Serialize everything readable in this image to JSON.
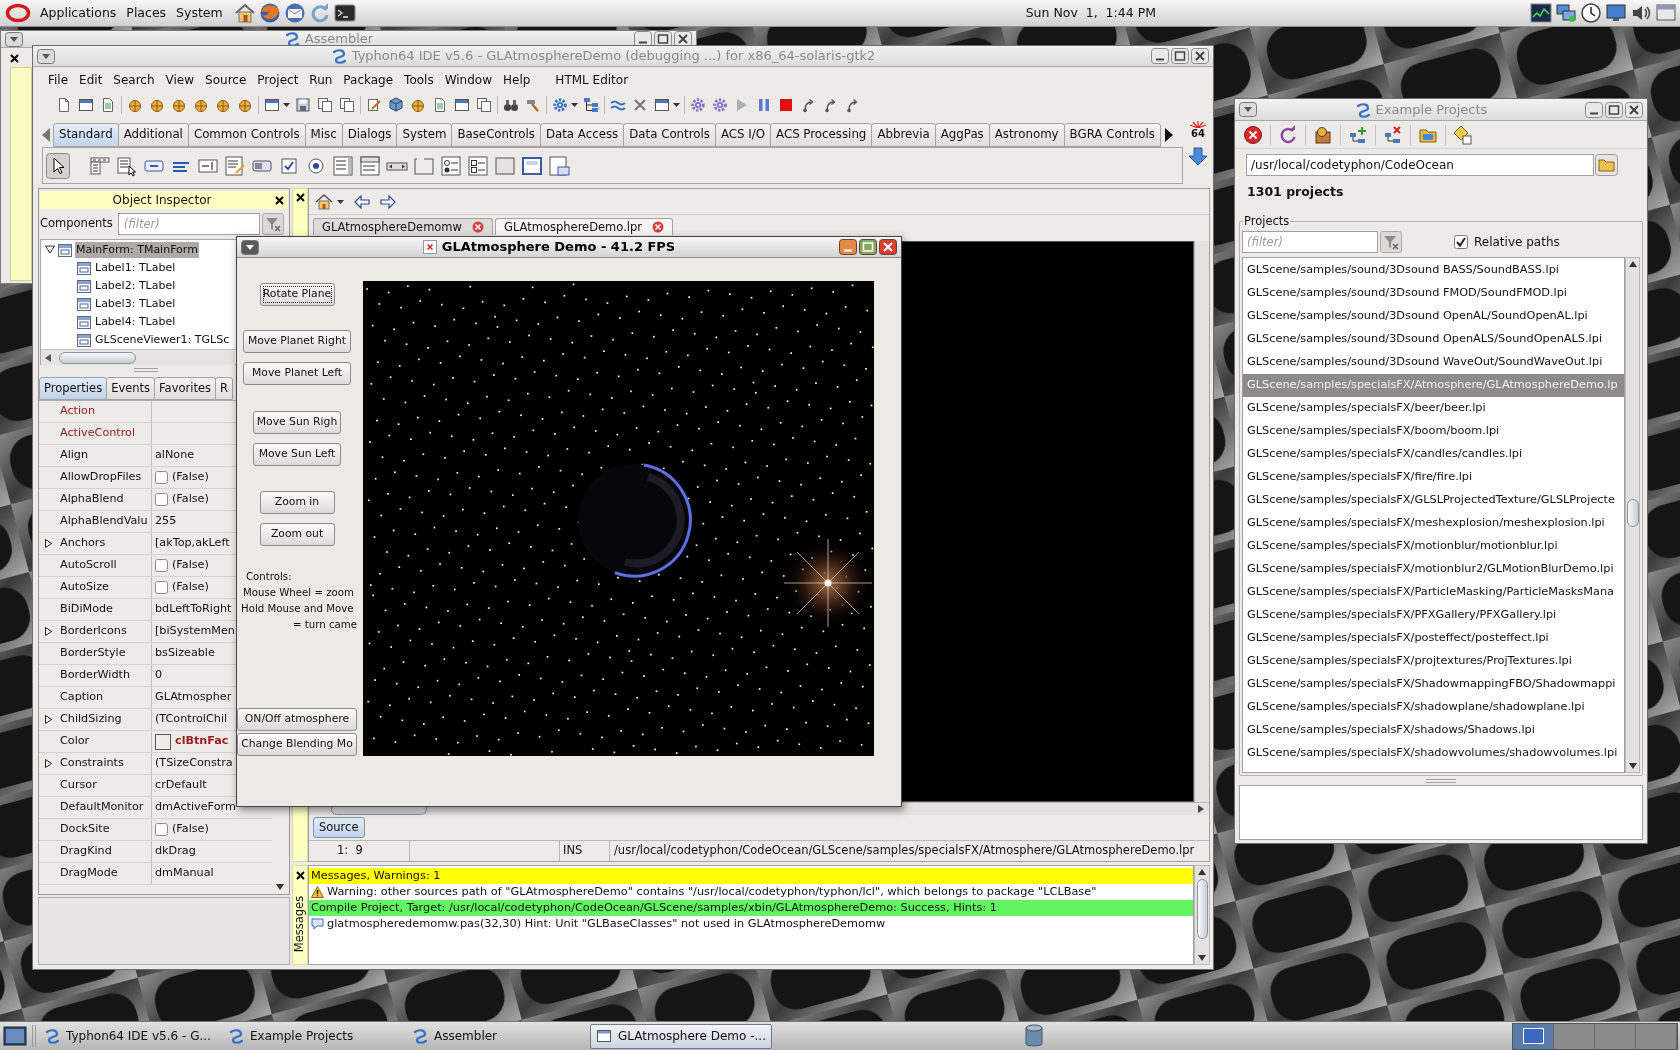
{
  "top_panel": {
    "menus": [
      "Applications",
      "Places",
      "System"
    ],
    "clock": "Sun Nov  1,  1:44 PM"
  },
  "assembler_window": {
    "title": "Assembler",
    "active": false
  },
  "ide_window": {
    "title": "Typhon64 IDE v5.6 - GLAtmosphereDemo (debugging ...) for x86_64-solaris-gtk2",
    "active": false,
    "menu": [
      "File",
      "Edit",
      "Search",
      "View",
      "Source",
      "Project",
      "Run",
      "Package",
      "Tools",
      "Window",
      "Help",
      "HTML Editor"
    ],
    "palette_tabs": [
      {
        "label": "Standard",
        "selected": true
      },
      {
        "label": "Additional",
        "selected": false
      },
      {
        "label": "Common Controls",
        "selected": false
      },
      {
        "label": "Misc",
        "selected": false
      },
      {
        "label": "Dialogs",
        "selected": false
      },
      {
        "label": "System",
        "selected": false
      },
      {
        "label": "BaseControls",
        "selected": false
      },
      {
        "label": "Data Access",
        "selected": false
      },
      {
        "label": "Data Controls",
        "selected": false
      },
      {
        "label": "ACS I/O",
        "selected": false
      },
      {
        "label": "ACS Processing",
        "selected": false
      },
      {
        "label": "Abbrevia",
        "selected": false
      },
      {
        "label": "AggPas",
        "selected": false
      },
      {
        "label": "Astronomy",
        "selected": false
      },
      {
        "label": "BGRA Controls",
        "selected": false
      }
    ],
    "palette_badge": "64",
    "object_inspector": {
      "title": "Object Inspector",
      "filter_label": "Components",
      "filter_placeholder": "(filter)",
      "tree": [
        {
          "label": "MainForm: TMainForm",
          "selected": true,
          "expanded": true,
          "children": [
            {
              "label": "Label1: TLabel",
              "selected": false
            },
            {
              "label": "Label2: TLabel",
              "selected": false
            },
            {
              "label": "Label3: TLabel",
              "selected": false
            },
            {
              "label": "Label4: TLabel",
              "selected": false
            },
            {
              "label": "GLSceneViewer1: TGLSc",
              "selected": false
            }
          ]
        }
      ],
      "tabs": [
        {
          "label": "Properties",
          "selected": true
        },
        {
          "label": "Events",
          "selected": false
        },
        {
          "label": "Favorites",
          "selected": false
        },
        {
          "label": "R",
          "selected": false
        }
      ],
      "properties": [
        {
          "name": "Action",
          "kind": "reference"
        },
        {
          "name": "ActiveControl",
          "kind": "reference"
        },
        {
          "name": "Align",
          "kind": "text",
          "value": "alNone"
        },
        {
          "name": "AllowDropFiles",
          "kind": "bool",
          "checked": false,
          "value": "(False)"
        },
        {
          "name": "AlphaBlend",
          "kind": "bool",
          "checked": false,
          "value": "(False)"
        },
        {
          "name": "AlphaBlendValu",
          "kind": "text",
          "value": "255"
        },
        {
          "name": "Anchors",
          "kind": "text",
          "expanded": false,
          "value": "[akTop,akLeft"
        },
        {
          "name": "AutoScroll",
          "kind": "bool",
          "checked": false,
          "value": "(False)"
        },
        {
          "name": "AutoSize",
          "kind": "bool",
          "checked": false,
          "value": "(False)"
        },
        {
          "name": "BiDiMode",
          "kind": "text",
          "value": "bdLeftToRight"
        },
        {
          "name": "BorderIcons",
          "kind": "text",
          "expanded": false,
          "value": "[biSystemMen"
        },
        {
          "name": "BorderStyle",
          "kind": "text",
          "value": "bsSizeable"
        },
        {
          "name": "BorderWidth",
          "kind": "text",
          "value": "0"
        },
        {
          "name": "Caption",
          "kind": "text",
          "value": "GLAtmospher"
        },
        {
          "name": "ChildSizing",
          "kind": "text",
          "expanded": false,
          "value": "(TControlChil"
        },
        {
          "name": "Color",
          "kind": "color",
          "value": "clBtnFac"
        },
        {
          "name": "Constraints",
          "kind": "text",
          "expanded": false,
          "value": "(TSizeConstra"
        },
        {
          "name": "Cursor",
          "kind": "text",
          "value": "crDefault"
        },
        {
          "name": "DefaultMonitor",
          "kind": "text",
          "value": "dmActiveForm"
        },
        {
          "name": "DockSite",
          "kind": "bool",
          "checked": false,
          "value": "(False)"
        },
        {
          "name": "DragKind",
          "kind": "text",
          "value": "dkDrag"
        },
        {
          "name": "DragMode",
          "kind": "text",
          "value": "dmManual"
        }
      ]
    },
    "editor": {
      "tabs": [
        {
          "label": "GLAtmosphereDemomw",
          "selected": false
        },
        {
          "label": "GLAtmosphereDemo.lpr",
          "selected": true
        }
      ],
      "page_tabs": [
        {
          "label": "Source",
          "selected": true
        }
      ],
      "status": {
        "position": "1:  9",
        "mode": "INS",
        "file": "/usr/local/codetyphon/CodeOcean/GLScene/samples/specialsFX/Atmosphere/GLAtmosphereDemo.lpr"
      }
    },
    "messages": {
      "title": "Messages",
      "rows": [
        {
          "kind": "header",
          "text": "Messages, Warnings: 1"
        },
        {
          "kind": "warning",
          "text": "Warning: other sources path of \"GLAtmosphereDemo\" contains \"/usr/local/codetyphon/typhon/lcl\", which belongs to package \"LCLBase\""
        },
        {
          "kind": "success",
          "text": "Compile Project, Target: /usr/local/codetyphon/CodeOcean/GLScene/samples/xbin/GLAtmosphereDemo: Success, Hints: 1"
        },
        {
          "kind": "hint",
          "text": "glatmospheredemomw.pas(32,30) Hint: Unit \"GLBaseClasses\" not used in GLAtmosphereDemomw"
        }
      ]
    }
  },
  "demo_window": {
    "title": "GLAtmosphere Demo - 41.2 FPS",
    "active": true,
    "button_groups": [
      [
        {
          "label": "Rotate Plane",
          "focused": true
        }
      ],
      [
        {
          "label": "Move Planet Right",
          "focused": false
        },
        {
          "label": "Move Planet Left",
          "focused": false
        }
      ],
      [
        {
          "label": "Move Sun Righ",
          "focused": false
        },
        {
          "label": "Move Sun Left",
          "focused": false
        }
      ],
      [
        {
          "label": "Zoom in",
          "focused": false
        },
        {
          "label": "Zoom out",
          "focused": false
        }
      ]
    ],
    "help_lines": [
      "Controls:",
      "Mouse Wheel = zoom",
      "Hold Mouse and Move",
      "= turn came"
    ],
    "bottom_buttons": [
      {
        "label": "ON/Off atmosphere",
        "focused": false
      },
      {
        "label": "Change Blending Mo",
        "focused": false
      }
    ]
  },
  "examples_window": {
    "title": "Example Projects",
    "active": false,
    "path": "/usr/local/codetyphon/CodeOcean",
    "count": "1301 projects",
    "projects_label": "Projects",
    "filter_placeholder": "(filter)",
    "relative_paths": {
      "label": "Relative paths",
      "checked": true
    },
    "projects": [
      {
        "path": "GLScene/samples/sound/3Dsound BASS/SoundBASS.lpi",
        "selected": false
      },
      {
        "path": "GLScene/samples/sound/3Dsound FMOD/SoundFMOD.lpi",
        "selected": false
      },
      {
        "path": "GLScene/samples/sound/3Dsound OpenAL/SoundOpenAL.lpi",
        "selected": false
      },
      {
        "path": "GLScene/samples/sound/3Dsound OpenALS/SoundOpenALS.lpi",
        "selected": false
      },
      {
        "path": "GLScene/samples/sound/3Dsound WaveOut/SoundWaveOut.lpi",
        "selected": false
      },
      {
        "path": "GLScene/samples/specialsFX/Atmosphere/GLAtmosphereDemo.lp",
        "selected": true
      },
      {
        "path": "GLScene/samples/specialsFX/beer/beer.lpi",
        "selected": false
      },
      {
        "path": "GLScene/samples/specialsFX/boom/boom.lpi",
        "selected": false
      },
      {
        "path": "GLScene/samples/specialsFX/candles/candles.lpi",
        "selected": false
      },
      {
        "path": "GLScene/samples/specialsFX/fire/fire.lpi",
        "selected": false
      },
      {
        "path": "GLScene/samples/specialsFX/GLSLProjectedTexture/GLSLProjecte",
        "selected": false
      },
      {
        "path": "GLScene/samples/specialsFX/meshexplosion/meshexplosion.lpi",
        "selected": false
      },
      {
        "path": "GLScene/samples/specialsFX/motionblur/motionblur.lpi",
        "selected": false
      },
      {
        "path": "GLScene/samples/specialsFX/motionblur2/GLMotionBlurDemo.lpi",
        "selected": false
      },
      {
        "path": "GLScene/samples/specialsFX/ParticleMasking/ParticleMasksMana",
        "selected": false
      },
      {
        "path": "GLScene/samples/specialsFX/PFXGallery/PFXGallery.lpi",
        "selected": false
      },
      {
        "path": "GLScene/samples/specialsFX/posteffect/posteffect.lpi",
        "selected": false
      },
      {
        "path": "GLScene/samples/specialsFX/projtextures/ProjTextures.lpi",
        "selected": false
      },
      {
        "path": "GLScene/samples/specialsFX/ShadowmappingFBO/Shadowmappi",
        "selected": false
      },
      {
        "path": "GLScene/samples/specialsFX/shadowplane/shadowplane.lpi",
        "selected": false
      },
      {
        "path": "GLScene/samples/specialsFX/shadows/Shadows.lpi",
        "selected": false
      },
      {
        "path": "GLScene/samples/specialsFX/shadowvolumes/shadowvolumes.lpi",
        "selected": false
      }
    ]
  },
  "taskbar": {
    "items": [
      {
        "label": "Typhon64 IDE v5.6 - G...",
        "kind": "typhon",
        "selected": false
      },
      {
        "label": "Example Projects",
        "kind": "typhon",
        "selected": false
      },
      {
        "label": "Assembler",
        "kind": "typhon",
        "selected": false
      },
      {
        "label": "GLAtmosphere Demo -...",
        "kind": "window",
        "selected": true
      }
    ],
    "workspaces": [
      {
        "selected": true
      },
      {
        "selected": false
      },
      {
        "selected": false
      },
      {
        "selected": false
      }
    ]
  }
}
